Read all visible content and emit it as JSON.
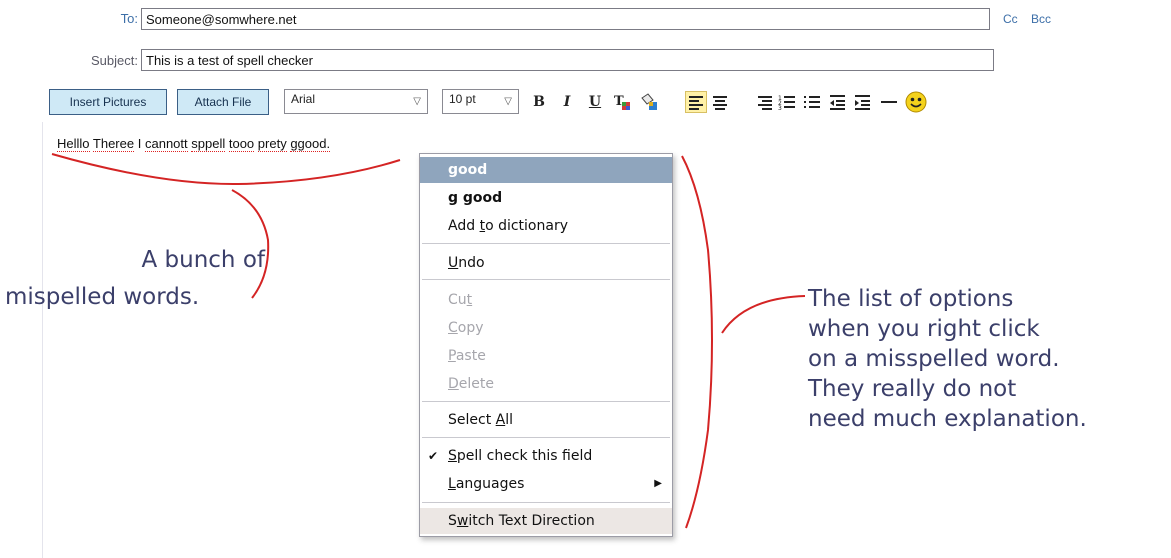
{
  "compose": {
    "to_label": "To:",
    "to_value": "Someone@somwhere.net",
    "cc_label": "Cc",
    "bcc_label": "Bcc",
    "subject_label": "Subject:",
    "subject_value": "This is a test of spell checker"
  },
  "toolbar": {
    "insert_pictures": "Insert Pictures",
    "attach_file": "Attach File",
    "font_family": "Arial",
    "font_size": "10 pt",
    "bold": "B",
    "italic": "I",
    "underline": "U"
  },
  "body": {
    "words": [
      "Helllo",
      "Theree",
      "I",
      "cannott",
      "sppell",
      "tooo",
      "prety",
      "ggood."
    ]
  },
  "context_menu": {
    "suggestion_1": "good",
    "suggestion_2": "g good",
    "add_to_dictionary": "Add to dictionary",
    "undo": "Undo",
    "cut": "Cut",
    "copy": "Copy",
    "paste": "Paste",
    "delete": "Delete",
    "select_all": "Select All",
    "spell_check": "Spell check this field",
    "languages": "Languages",
    "switch_direction": "Switch Text Direction"
  },
  "annotations": {
    "left_line_1": "A bunch of",
    "left_line_2": "mispelled words.",
    "right_lines": [
      "The list of options",
      "when you right click",
      "on a misspelled word.",
      "They really do not",
      "need much explanation."
    ]
  },
  "colors": {
    "accent": "#3b5f86",
    "button_fill": "#cfe9f6",
    "menu_highlight": "#8fa5bd",
    "annotation_ink": "#3b3f6a",
    "callout_stroke": "#d42424"
  },
  "icons": [
    "text-color-icon",
    "background-color-icon",
    "align-left-icon",
    "align-center-icon",
    "align-right-icon",
    "numbered-list-icon",
    "bullet-list-icon",
    "outdent-icon",
    "indent-icon",
    "horizontal-rule-icon",
    "smiley-icon"
  ]
}
